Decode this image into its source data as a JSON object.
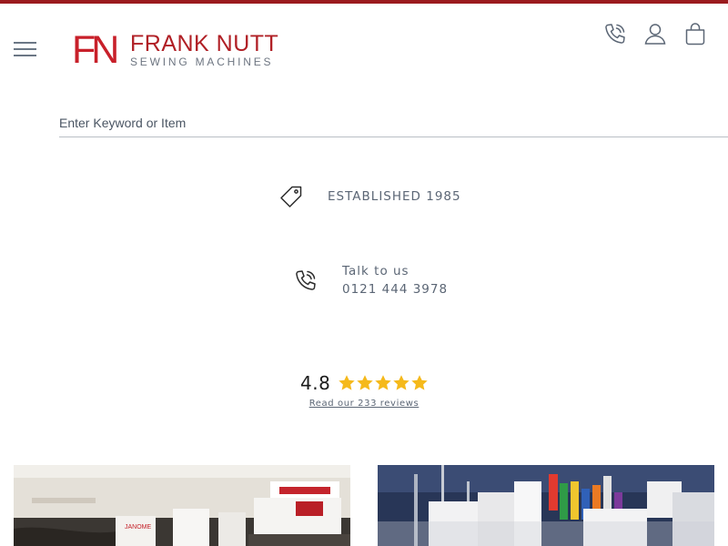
{
  "brand": {
    "monogram": "FN",
    "name": "FRANK NUTT",
    "tagline": "SEWING MACHINES"
  },
  "header": {
    "icons": [
      "phone-icon",
      "user-icon",
      "shopping-bag-icon"
    ]
  },
  "search": {
    "placeholder": "Enter Keyword or Item",
    "value": ""
  },
  "usps": {
    "established": "ESTABLISHED 1985",
    "talk_label": "Talk to us",
    "talk_phone": "0121 444 3978"
  },
  "rating": {
    "score": "4.8",
    "stars": 5,
    "reviews_link": "Read our 233 reviews"
  },
  "colors": {
    "brand_red": "#c8202a",
    "top_bar": "#9b1b1e",
    "star": "#f5b91b",
    "text_grey": "#5b6675"
  },
  "photos": [
    {
      "name": "showroom-photo-left"
    },
    {
      "name": "showroom-photo-right"
    }
  ]
}
